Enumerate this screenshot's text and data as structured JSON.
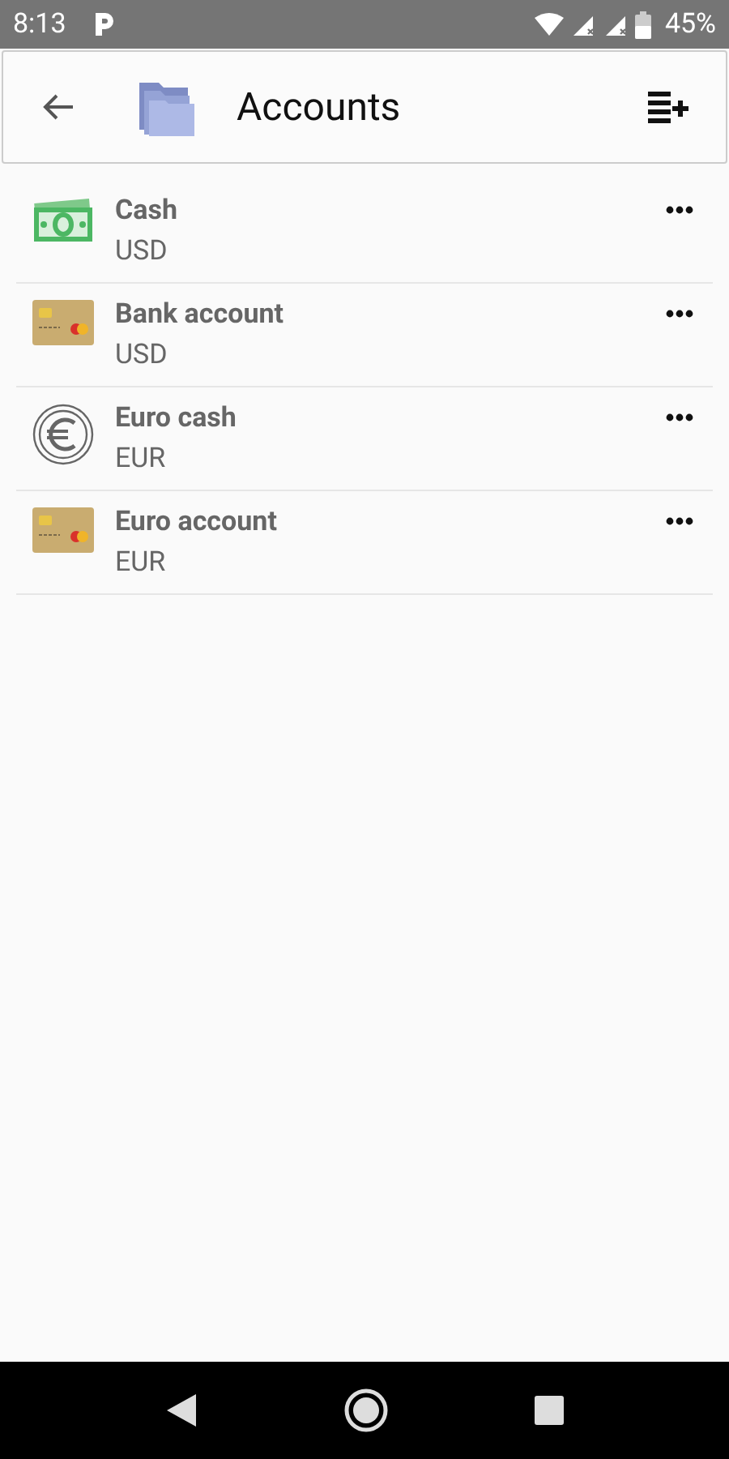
{
  "status_bar": {
    "time": "8:13",
    "battery": "45%"
  },
  "header": {
    "title": "Accounts"
  },
  "accounts": [
    {
      "kind": "cash",
      "name": "Cash",
      "currency": "USD"
    },
    {
      "kind": "card",
      "name": "Bank account",
      "currency": "USD"
    },
    {
      "kind": "euro",
      "name": "Euro cash",
      "currency": "EUR"
    },
    {
      "kind": "card",
      "name": "Euro account",
      "currency": "EUR"
    }
  ]
}
